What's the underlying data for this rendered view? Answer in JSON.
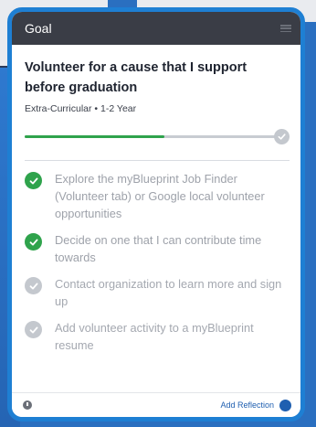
{
  "header": {
    "title": "Goal"
  },
  "goal": {
    "title": "Volunteer for a cause that I support before graduation",
    "meta": "Extra-Curricular • 1-2 Year",
    "progress": 0.55
  },
  "tasks": [
    {
      "label": "Explore the myBlueprint Job Finder (Volunteer tab) or Google local volunteer opportunities",
      "done": true
    },
    {
      "label": "Decide on one that I can contribute time towards",
      "done": true
    },
    {
      "label": "Contact organization to learn more and sign up",
      "done": false
    },
    {
      "label": "Add volunteer activity to a myBlueprint resume",
      "done": false
    }
  ],
  "footer": {
    "add_reflection_label": "Add Reflection"
  },
  "colors": {
    "accent_green": "#2fa34c",
    "frame_blue": "#1e7fd3",
    "header_dark": "#3a3d46"
  },
  "icons": {
    "menu": "menu-icon",
    "check": "check-icon",
    "clock": "clock-icon",
    "reflection": "reflection-icon"
  }
}
